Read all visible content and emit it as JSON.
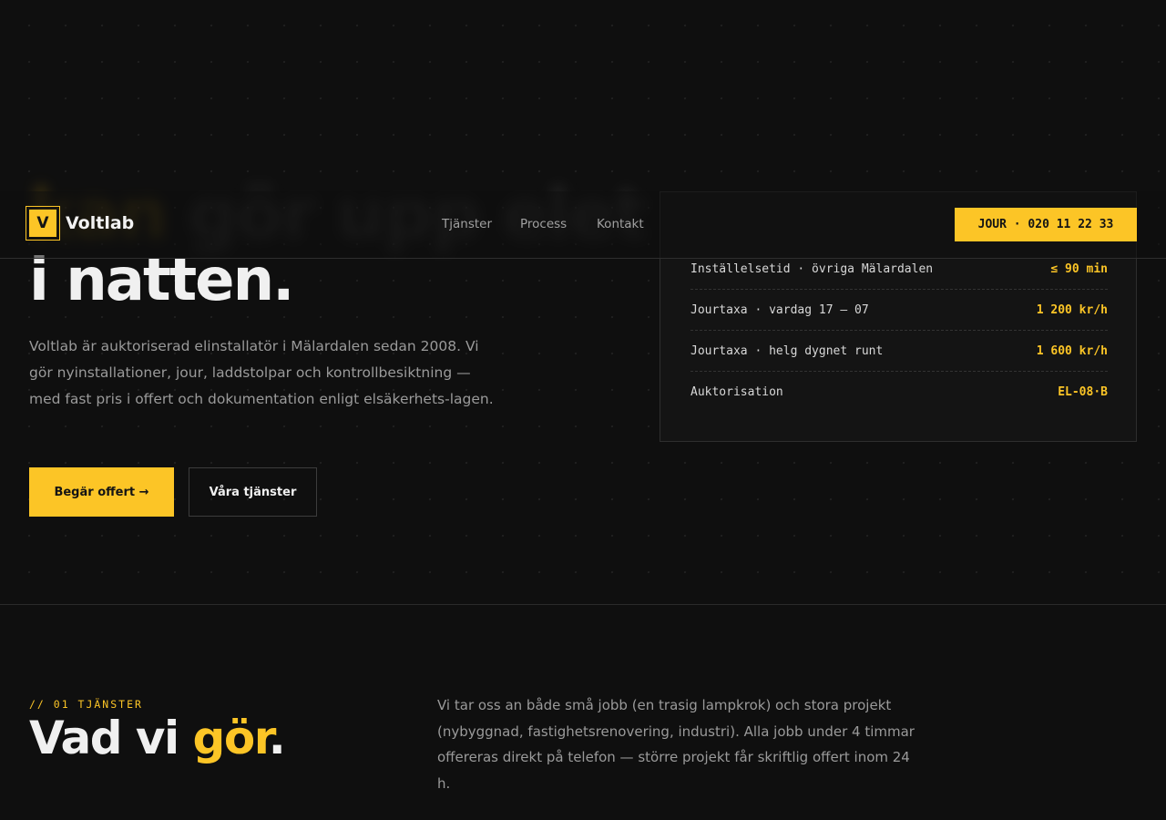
{
  "brand": {
    "logo_letter": "V",
    "name": "Voltlab",
    "accent_color": "#fcc526"
  },
  "nav": {
    "items": [
      {
        "label": "Tjänster"
      },
      {
        "label": "Process"
      },
      {
        "label": "Kontakt"
      }
    ],
    "jour_button": "JOUR · 020 11 22 33"
  },
  "hero": {
    "title_line_1_start": "Vi",
    "title_line_1_accent": "kan",
    "title_line_1_end": "gör upp elet",
    "title_line_2": "i natten.",
    "description": "Voltlab är auktoriserad elinstallatör i Mälardalen sedan 2008. Vi gör nyinstallationer, jour, laddstolpar och kontrollbesiktning — med fast pris i offert och dokumentation enligt elsäkerhets-lagen.",
    "primary_cta": "Begär offert →",
    "secondary_cta": "Våra tjänster"
  },
  "info_card": {
    "rows": [
      {
        "label": "Inställelsetid · övriga Mälardalen",
        "value": "≤ 90 min"
      },
      {
        "label": "Jourtaxa · vardag 17 – 07",
        "value": "1 200 kr/h"
      },
      {
        "label": "Jourtaxa · helg dygnet runt",
        "value": "1 600 kr/h"
      },
      {
        "label": "Auktorisation",
        "value": "EL-08·B"
      }
    ]
  },
  "services": {
    "eyebrow": "// 01 TJÄNSTER",
    "title_start": "Vad vi ",
    "title_accent": "gör",
    "title_end": ".",
    "description": "Vi tar oss an både små jobb (en trasig lampkrok) och stora projekt (nybyggnad, fastighetsrenovering, industri). Alla jobb under 4 timmar offereras direkt på telefon — större projekt får skriftlig offert inom 24 h."
  }
}
